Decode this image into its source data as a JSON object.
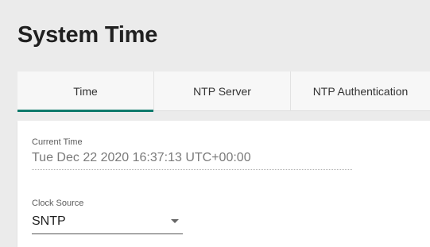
{
  "page": {
    "title": "System Time"
  },
  "tabs": [
    {
      "label": "Time",
      "active": true
    },
    {
      "label": "NTP Server",
      "active": false
    },
    {
      "label": "NTP Authentication",
      "active": false
    }
  ],
  "time_panel": {
    "current_time": {
      "label": "Current Time",
      "value": "Tue Dec 22 2020 16:37:13 UTC+00:00"
    },
    "clock_source": {
      "label": "Clock Source",
      "value": "SNTP",
      "icon": "chevron-down-icon"
    }
  },
  "colors": {
    "accent": "#0f7a6c",
    "page_background": "#ebebeb",
    "card_background": "#ffffff"
  }
}
